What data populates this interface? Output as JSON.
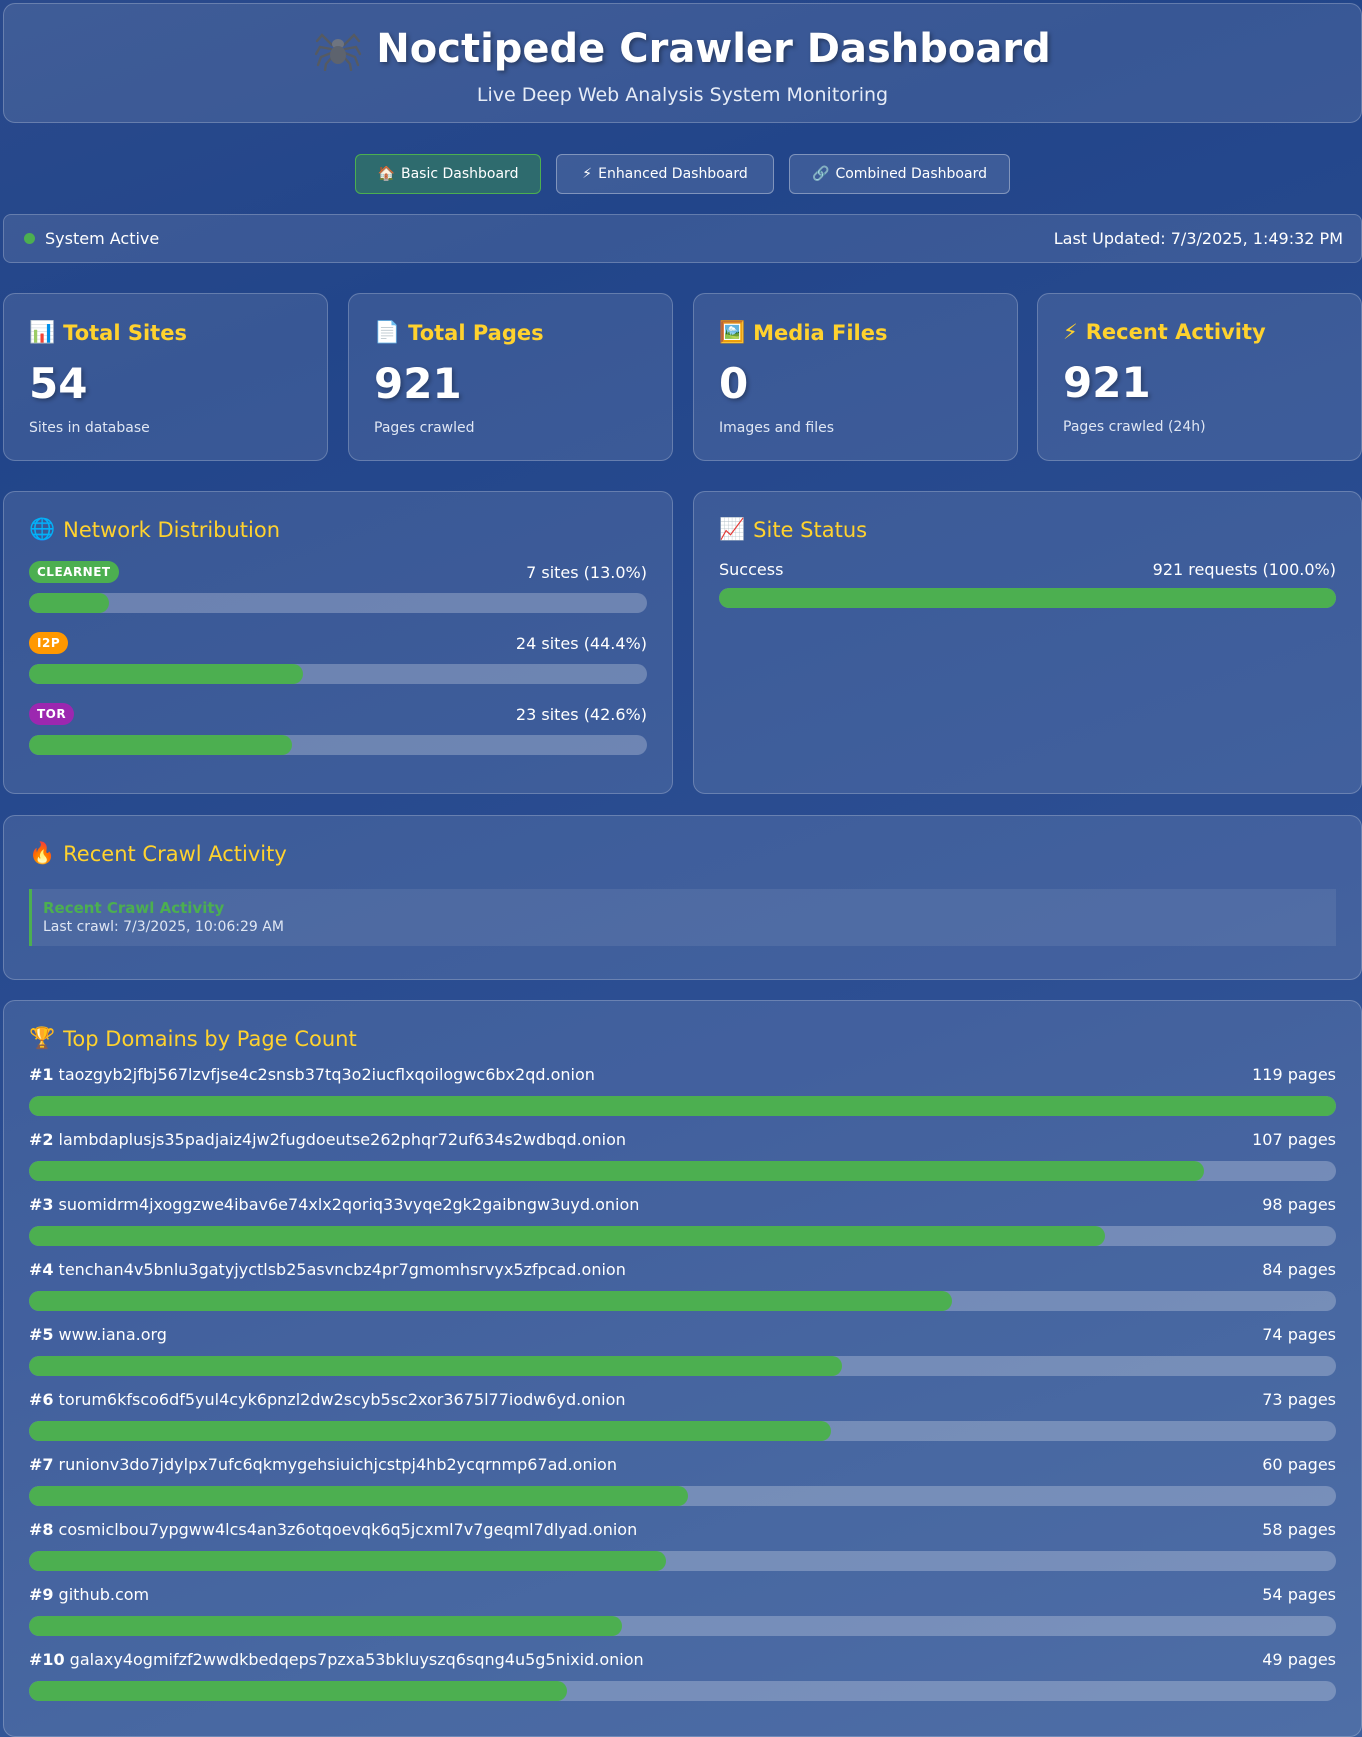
{
  "header": {
    "title": "Noctipede Crawler Dashboard",
    "subtitle": "Live Deep Web Analysis System Monitoring"
  },
  "nav": [
    {
      "icon": "🏠",
      "label": "Basic Dashboard",
      "active": true
    },
    {
      "icon": "⚡",
      "label": "Enhanced Dashboard",
      "active": false
    },
    {
      "icon": "🔗",
      "label": "Combined Dashboard",
      "active": false
    }
  ],
  "status": {
    "text": "System Active",
    "last_updated": "Last Updated: 7/3/2025, 1:49:32 PM"
  },
  "stats": [
    {
      "icon": "📊",
      "title": "Total Sites",
      "value": "54",
      "desc": "Sites in database"
    },
    {
      "icon": "📄",
      "title": "Total Pages",
      "value": "921",
      "desc": "Pages crawled"
    },
    {
      "icon": "🖼️",
      "title": "Media Files",
      "value": "0",
      "desc": "Images and files"
    },
    {
      "icon": "⚡",
      "title": "Recent Activity",
      "value": "921",
      "desc": "Pages crawled (24h)"
    }
  ],
  "network": {
    "icon": "🌐",
    "title": "Network Distribution",
    "items": [
      {
        "label": "CLEARNET",
        "color": "#4caf50",
        "text": "7 sites (13.0%)",
        "percent": 13.0
      },
      {
        "label": "I2P",
        "color": "#ff9800",
        "text": "24 sites (44.4%)",
        "percent": 44.4
      },
      {
        "label": "TOR",
        "color": "#9c27b0",
        "text": "23 sites (42.6%)",
        "percent": 42.6
      }
    ]
  },
  "site_status": {
    "icon": "📈",
    "title": "Site Status",
    "items": [
      {
        "label": "Success",
        "text": "921 requests (100.0%)",
        "percent": 100.0
      }
    ]
  },
  "recent": {
    "icon": "🔥",
    "title": "Recent Crawl Activity",
    "item_title": "Recent Crawl Activity",
    "item_detail": "Last crawl: 7/3/2025, 10:06:29 AM"
  },
  "domains": {
    "icon": "🏆",
    "title": "Top Domains by Page Count",
    "max_pages": 119,
    "items": [
      {
        "rank": "#1",
        "domain": "taozgyb2jfbj567lzvfjse4c2snsb37tq3o2iucflxqoilogwc6bx2qd.onion",
        "pages_text": "119 pages",
        "pages": 119
      },
      {
        "rank": "#2",
        "domain": "lambdaplusjs35padjaiz4jw2fugdoeutse262phqr72uf634s2wdbqd.onion",
        "pages_text": "107 pages",
        "pages": 107
      },
      {
        "rank": "#3",
        "domain": "suomidrm4jxoggzwe4ibav6e74xlx2qoriq33vyqe2gk2gaibngw3uyd.onion",
        "pages_text": "98 pages",
        "pages": 98
      },
      {
        "rank": "#4",
        "domain": "tenchan4v5bnlu3gatyjyctlsb25asvncbz4pr7gmomhsrvyx5zfpcad.onion",
        "pages_text": "84 pages",
        "pages": 84
      },
      {
        "rank": "#5",
        "domain": "www.iana.org",
        "pages_text": "74 pages",
        "pages": 74
      },
      {
        "rank": "#6",
        "domain": "torum6kfsco6df5yul4cyk6pnzl2dw2scyb5sc2xor3675l77iodw6yd.onion",
        "pages_text": "73 pages",
        "pages": 73
      },
      {
        "rank": "#7",
        "domain": "runionv3do7jdylpx7ufc6qkmygehsiuichjcstpj4hb2ycqrnmp67ad.onion",
        "pages_text": "60 pages",
        "pages": 60
      },
      {
        "rank": "#8",
        "domain": "cosmiclbou7ypgww4lcs4an3z6otqoevqk6q5jcxml7v7geqml7dlyad.onion",
        "pages_text": "58 pages",
        "pages": 58
      },
      {
        "rank": "#9",
        "domain": "github.com",
        "pages_text": "54 pages",
        "pages": 54
      },
      {
        "rank": "#10",
        "domain": "galaxy4ogmifzf2wwdkbedqeps7pzxa53bkluyszq6sqng4u5g5nixid.onion",
        "pages_text": "49 pages",
        "pages": 49
      }
    ]
  }
}
